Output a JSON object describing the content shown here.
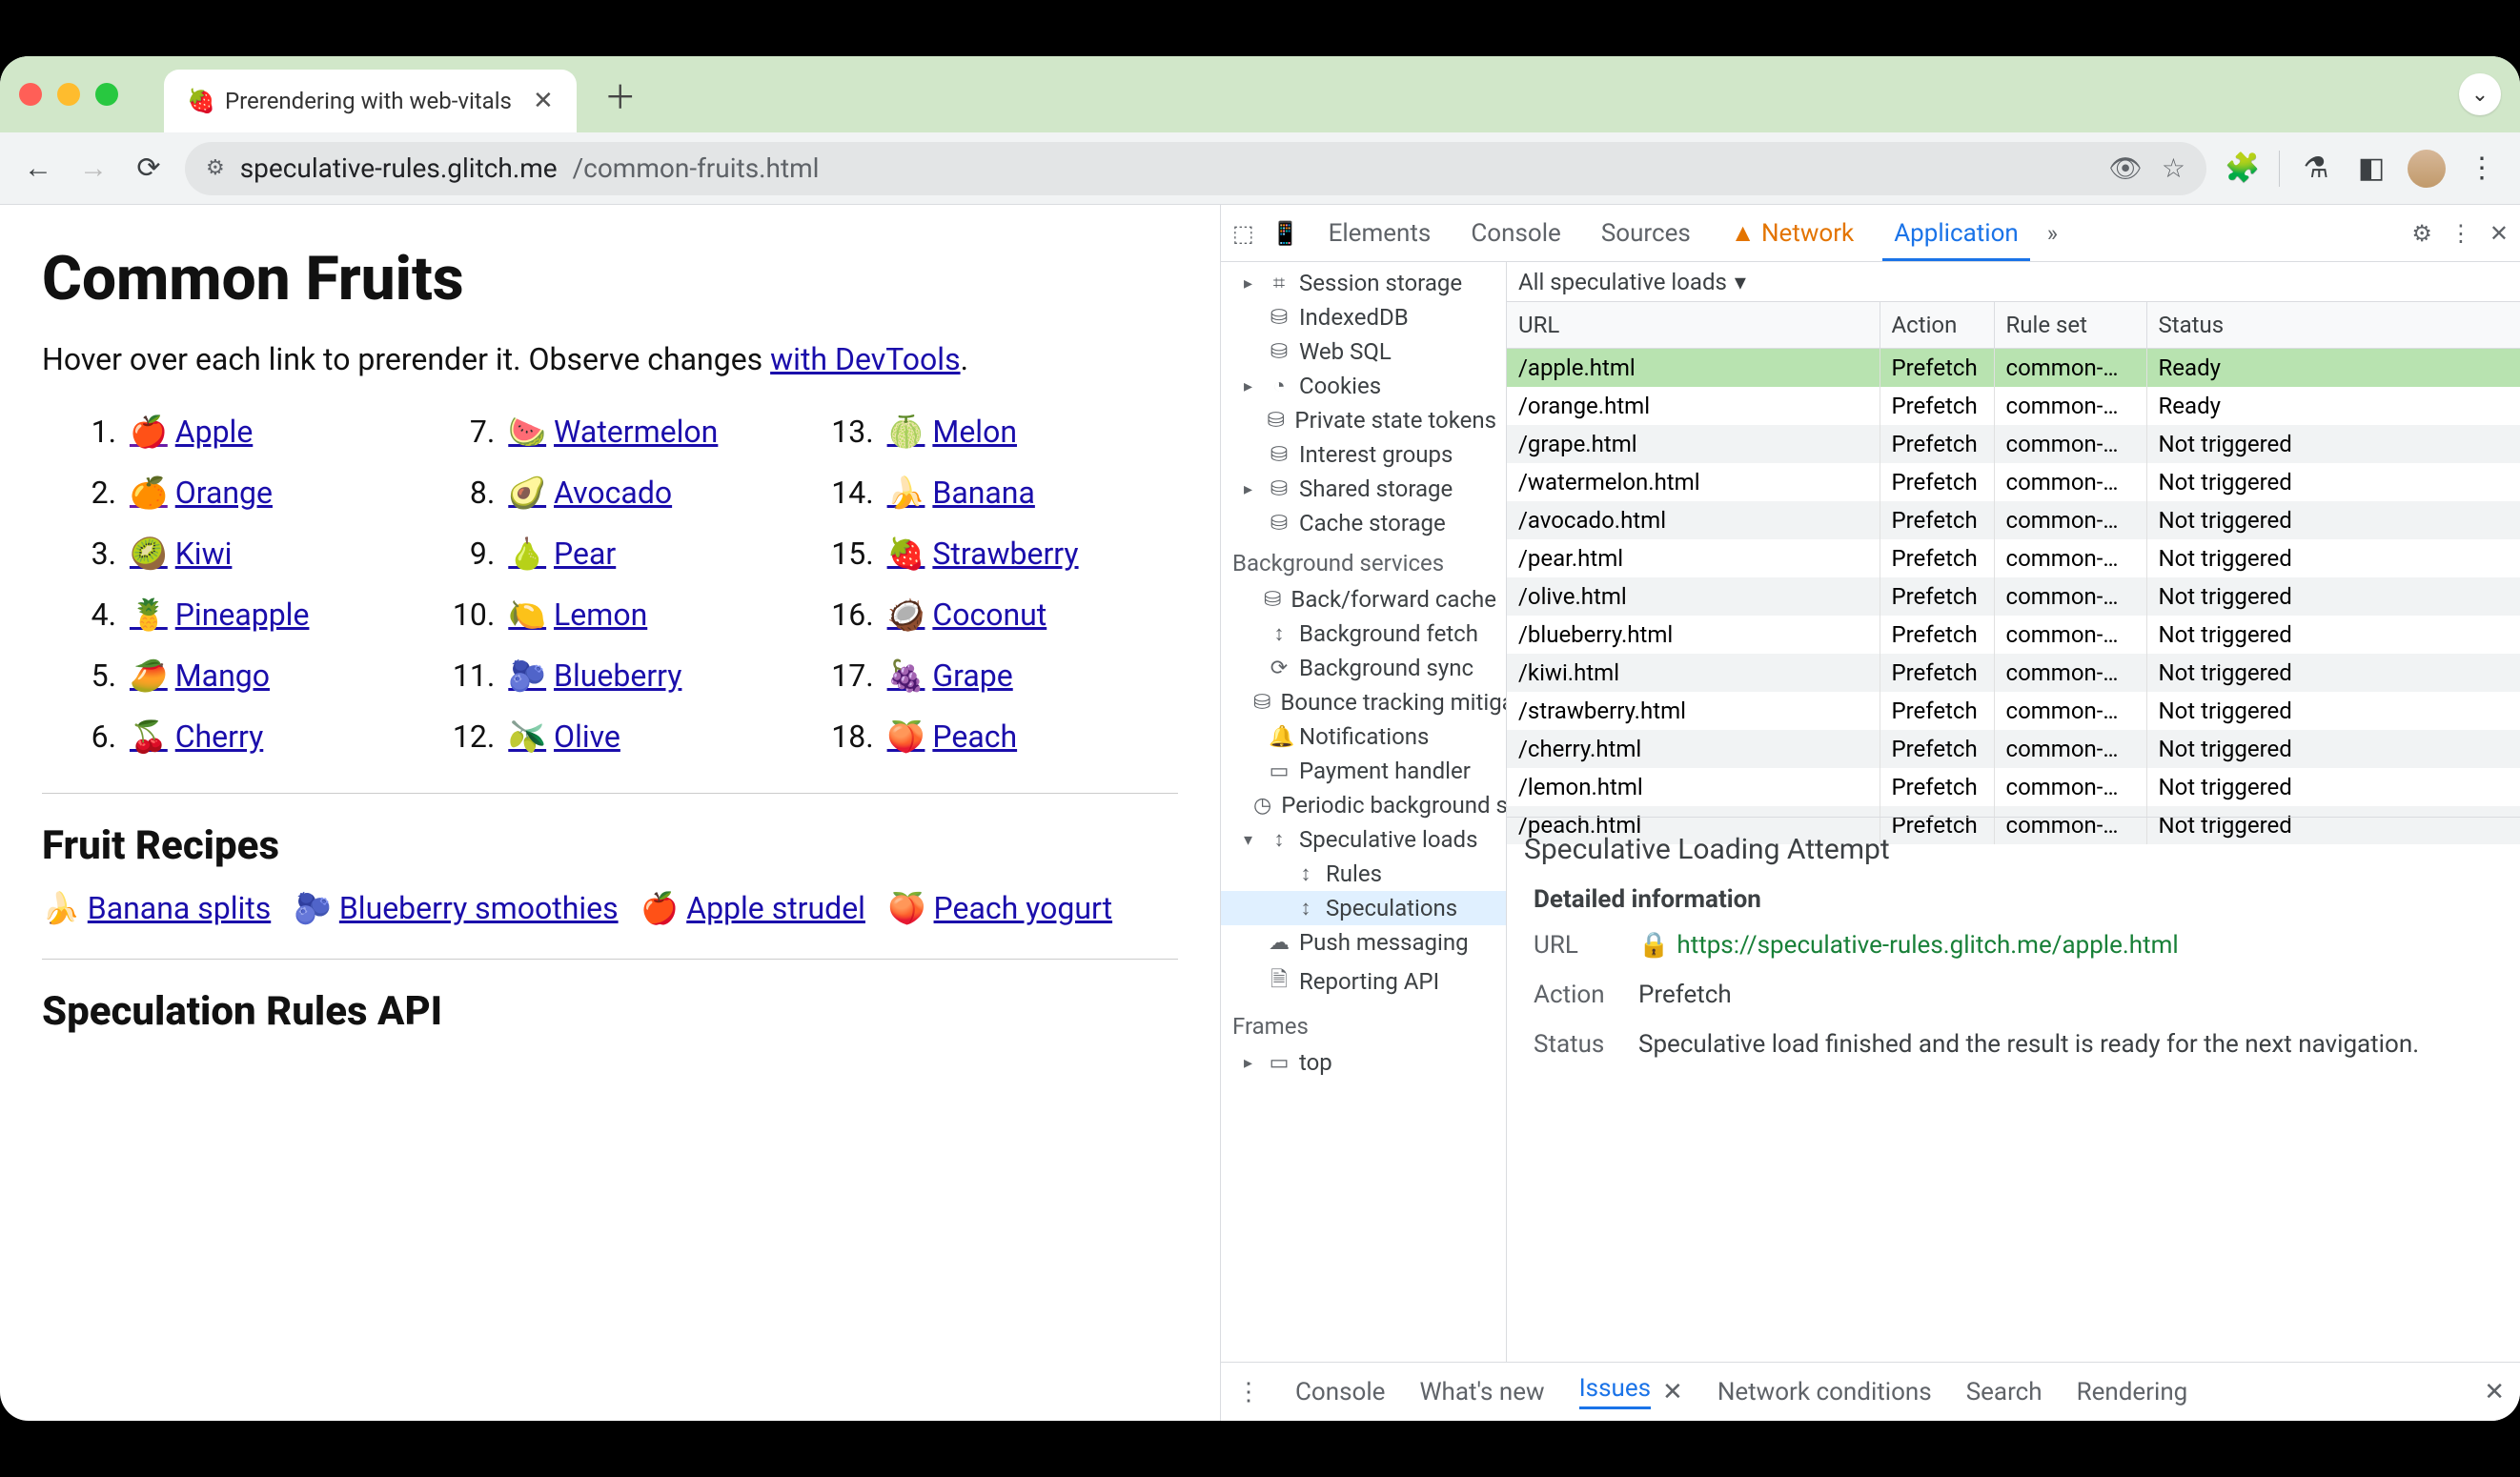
{
  "window": {
    "tab_title": "Prerendering with web-vitals",
    "url_domain": "speculative-rules.glitch.me",
    "url_path": "/common-fruits.html"
  },
  "page": {
    "title": "Common Fruits",
    "intro_1": "Hover over each link to prerender it. Observe changes ",
    "intro_link": "with DevTools",
    "intro_2": ".",
    "fruits": [
      {
        "n": "1.",
        "emoji": "🍎",
        "name": "Apple",
        "visited": true
      },
      {
        "n": "2.",
        "emoji": "🍊",
        "name": "Orange",
        "visited": true
      },
      {
        "n": "3.",
        "emoji": "🥝",
        "name": "Kiwi"
      },
      {
        "n": "4.",
        "emoji": "🍍",
        "name": "Pineapple"
      },
      {
        "n": "5.",
        "emoji": "🥭",
        "name": "Mango"
      },
      {
        "n": "6.",
        "emoji": "🍒",
        "name": "Cherry"
      },
      {
        "n": "7.",
        "emoji": "🍉",
        "name": "Watermelon"
      },
      {
        "n": "8.",
        "emoji": "🥑",
        "name": "Avocado"
      },
      {
        "n": "9.",
        "emoji": "🍐",
        "name": "Pear"
      },
      {
        "n": "10.",
        "emoji": "🍋",
        "name": "Lemon"
      },
      {
        "n": "11.",
        "emoji": "🫐",
        "name": "Blueberry"
      },
      {
        "n": "12.",
        "emoji": "🫒",
        "name": "Olive"
      },
      {
        "n": "13.",
        "emoji": "🍈",
        "name": "Melon"
      },
      {
        "n": "14.",
        "emoji": "🍌",
        "name": "Banana"
      },
      {
        "n": "15.",
        "emoji": "🍓",
        "name": "Strawberry"
      },
      {
        "n": "16.",
        "emoji": "🥥",
        "name": "Coconut"
      },
      {
        "n": "17.",
        "emoji": "🍇",
        "name": "Grape"
      },
      {
        "n": "18.",
        "emoji": "🍑",
        "name": "Peach"
      }
    ],
    "recipes_heading": "Fruit Recipes",
    "recipes": [
      {
        "emoji": "🍌",
        "name": "Banana splits"
      },
      {
        "emoji": "🫐",
        "name": "Blueberry smoothies"
      },
      {
        "emoji": "🍎",
        "name": "Apple strudel"
      },
      {
        "emoji": "🍑",
        "name": "Peach yogurt"
      }
    ],
    "api_heading": "Speculation Rules API"
  },
  "devtools": {
    "tabs": [
      "Elements",
      "Console",
      "Sources",
      "Network",
      "Application"
    ],
    "network_warn": true,
    "active_tab": "Application",
    "sidebar": {
      "storage": [
        {
          "label": "Session storage",
          "icon": "⌗",
          "caret": "▸"
        },
        {
          "label": "IndexedDB",
          "icon": "⛁"
        },
        {
          "label": "Web SQL",
          "icon": "⛁"
        },
        {
          "label": "Cookies",
          "icon": "◔",
          "caret": "▸"
        },
        {
          "label": "Private state tokens",
          "icon": "⛁"
        },
        {
          "label": "Interest groups",
          "icon": "⛁"
        },
        {
          "label": "Shared storage",
          "icon": "⛁",
          "caret": "▸"
        },
        {
          "label": "Cache storage",
          "icon": "⛁"
        }
      ],
      "bg_heading": "Background services",
      "bg": [
        {
          "label": "Back/forward cache",
          "icon": "⛁"
        },
        {
          "label": "Background fetch",
          "icon": "↕"
        },
        {
          "label": "Background sync",
          "icon": "⟳"
        },
        {
          "label": "Bounce tracking mitigation",
          "icon": "⛁"
        },
        {
          "label": "Notifications",
          "icon": "🔔"
        },
        {
          "label": "Payment handler",
          "icon": "▭"
        },
        {
          "label": "Periodic background sync",
          "icon": "◷"
        },
        {
          "label": "Speculative loads",
          "icon": "↕",
          "caret": "▾",
          "expanded": true,
          "children": [
            {
              "label": "Rules",
              "icon": "↕"
            },
            {
              "label": "Speculations",
              "icon": "↕",
              "selected": true
            }
          ]
        },
        {
          "label": "Push messaging",
          "icon": "☁"
        },
        {
          "label": "Reporting API",
          "icon": "🗎"
        }
      ],
      "frames_heading": "Frames",
      "frames": [
        {
          "label": "top",
          "icon": "▭",
          "caret": "▸"
        }
      ]
    },
    "filter_label": "All speculative loads",
    "table": {
      "headers": [
        "URL",
        "Action",
        "Rule set",
        "Status"
      ],
      "rows": [
        {
          "url": "/apple.html",
          "action": "Prefetch",
          "ruleset": "common-…",
          "status": "Ready",
          "selected": true
        },
        {
          "url": "/orange.html",
          "action": "Prefetch",
          "ruleset": "common-…",
          "status": "Ready"
        },
        {
          "url": "/grape.html",
          "action": "Prefetch",
          "ruleset": "common-…",
          "status": "Not triggered"
        },
        {
          "url": "/watermelon.html",
          "action": "Prefetch",
          "ruleset": "common-…",
          "status": "Not triggered"
        },
        {
          "url": "/avocado.html",
          "action": "Prefetch",
          "ruleset": "common-…",
          "status": "Not triggered"
        },
        {
          "url": "/pear.html",
          "action": "Prefetch",
          "ruleset": "common-…",
          "status": "Not triggered"
        },
        {
          "url": "/olive.html",
          "action": "Prefetch",
          "ruleset": "common-…",
          "status": "Not triggered"
        },
        {
          "url": "/blueberry.html",
          "action": "Prefetch",
          "ruleset": "common-…",
          "status": "Not triggered"
        },
        {
          "url": "/kiwi.html",
          "action": "Prefetch",
          "ruleset": "common-…",
          "status": "Not triggered"
        },
        {
          "url": "/strawberry.html",
          "action": "Prefetch",
          "ruleset": "common-…",
          "status": "Not triggered"
        },
        {
          "url": "/cherry.html",
          "action": "Prefetch",
          "ruleset": "common-…",
          "status": "Not triggered"
        },
        {
          "url": "/lemon.html",
          "action": "Prefetch",
          "ruleset": "common-…",
          "status": "Not triggered"
        },
        {
          "url": "/peach.html",
          "action": "Prefetch",
          "ruleset": "common-…",
          "status": "Not triggered"
        }
      ]
    },
    "detail": {
      "title": "Speculative Loading Attempt",
      "subtitle": "Detailed information",
      "url_label": "URL",
      "url": "https://speculative-rules.glitch.me/apple.html",
      "action_label": "Action",
      "action": "Prefetch",
      "status_label": "Status",
      "status": "Speculative load finished and the result is ready for the next navigation."
    },
    "drawer": [
      "Console",
      "What's new",
      "Issues",
      "Network conditions",
      "Search",
      "Rendering"
    ],
    "drawer_active": "Issues"
  }
}
